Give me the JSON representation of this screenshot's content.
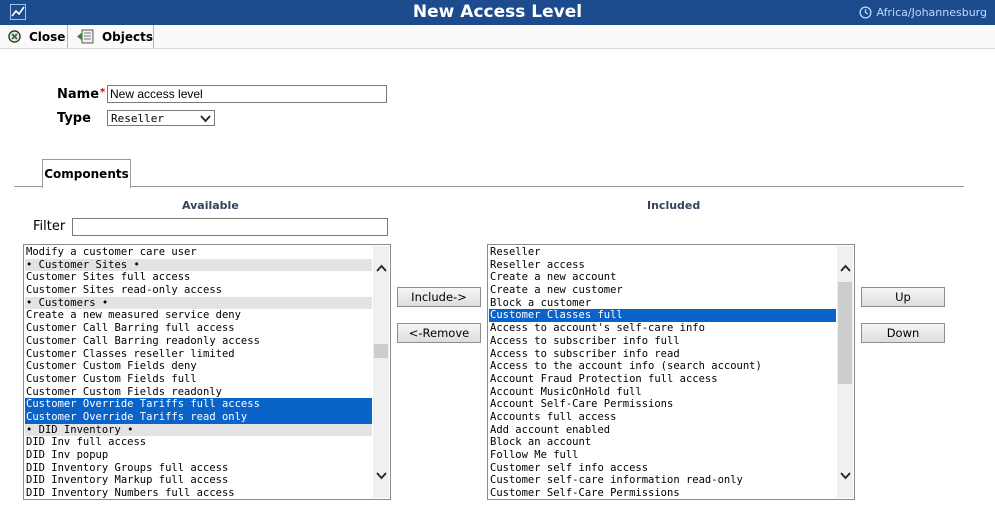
{
  "window": {
    "title": "New Access Level",
    "timezone": "Africa/Johannesburg"
  },
  "toolbar": {
    "close_label": "Close",
    "objects_label": "Objects"
  },
  "form": {
    "name_label": "Name",
    "required_mark": "*",
    "name_value": "New access level",
    "type_label": "Type",
    "type_value": "Reseller"
  },
  "tabs": {
    "components": "Components"
  },
  "available": {
    "heading": "Available",
    "filter_label": "Filter",
    "filter_value": "",
    "items": [
      {
        "text": "Modify a customer care user",
        "kind": "item"
      },
      {
        "text": "• Customer Sites •",
        "kind": "group"
      },
      {
        "text": "Customer Sites full access",
        "kind": "item"
      },
      {
        "text": "Customer Sites read-only access",
        "kind": "item"
      },
      {
        "text": "• Customers •",
        "kind": "group"
      },
      {
        "text": "Create a new measured service deny",
        "kind": "item"
      },
      {
        "text": "Customer Call Barring full access",
        "kind": "item"
      },
      {
        "text": "Customer Call Barring readonly access",
        "kind": "item"
      },
      {
        "text": "Customer Classes reseller limited",
        "kind": "item"
      },
      {
        "text": "Customer Custom Fields deny",
        "kind": "item"
      },
      {
        "text": "Customer Custom Fields full",
        "kind": "item"
      },
      {
        "text": "Customer Custom Fields readonly",
        "kind": "item"
      },
      {
        "text": "Customer Override Tariffs full access",
        "kind": "selected"
      },
      {
        "text": "Customer Override Tariffs read only",
        "kind": "selected"
      },
      {
        "text": "• DID Inventory •",
        "kind": "group"
      },
      {
        "text": "DID Inv full access",
        "kind": "item"
      },
      {
        "text": "DID Inv popup",
        "kind": "item"
      },
      {
        "text": "DID Inventory Groups full access",
        "kind": "item"
      },
      {
        "text": "DID Inventory Markup full access",
        "kind": "item"
      },
      {
        "text": "DID Inventory Numbers full access",
        "kind": "item"
      }
    ]
  },
  "included": {
    "heading": "Included",
    "items": [
      {
        "text": "Reseller",
        "kind": "item"
      },
      {
        "text": "Reseller access",
        "kind": "item"
      },
      {
        "text": "Create a new account",
        "kind": "item"
      },
      {
        "text": "Create a new customer",
        "kind": "item"
      },
      {
        "text": "Block a customer",
        "kind": "item"
      },
      {
        "text": "Customer Classes full",
        "kind": "selected"
      },
      {
        "text": "Access to account's self-care info",
        "kind": "item"
      },
      {
        "text": "Access to subscriber info full",
        "kind": "item"
      },
      {
        "text": "Access to subscriber info read",
        "kind": "item"
      },
      {
        "text": "Access to the account info (search account)",
        "kind": "item"
      },
      {
        "text": "Account Fraud Protection full access",
        "kind": "item"
      },
      {
        "text": "Account MusicOnHold full",
        "kind": "item"
      },
      {
        "text": "Account Self-Care Permissions",
        "kind": "item"
      },
      {
        "text": "Accounts full access",
        "kind": "item"
      },
      {
        "text": "Add account enabled",
        "kind": "item"
      },
      {
        "text": "Block an account",
        "kind": "item"
      },
      {
        "text": "Follow Me full",
        "kind": "item"
      },
      {
        "text": "Customer self info access",
        "kind": "item"
      },
      {
        "text": "Customer self-care information read-only",
        "kind": "item"
      },
      {
        "text": "Customer Self-Care Permissions",
        "kind": "item"
      }
    ]
  },
  "buttons": {
    "include": "Include->",
    "remove": "<-Remove",
    "up": "Up",
    "down": "Down"
  },
  "colors": {
    "titlebar": "#1c4b8e",
    "selection": "#0a63c9",
    "group_row": "#e3e3e3"
  },
  "icons": {
    "app": "chart-line-icon",
    "timezone": "clock-icon",
    "close": "close-icon",
    "objects": "objects-icon"
  }
}
